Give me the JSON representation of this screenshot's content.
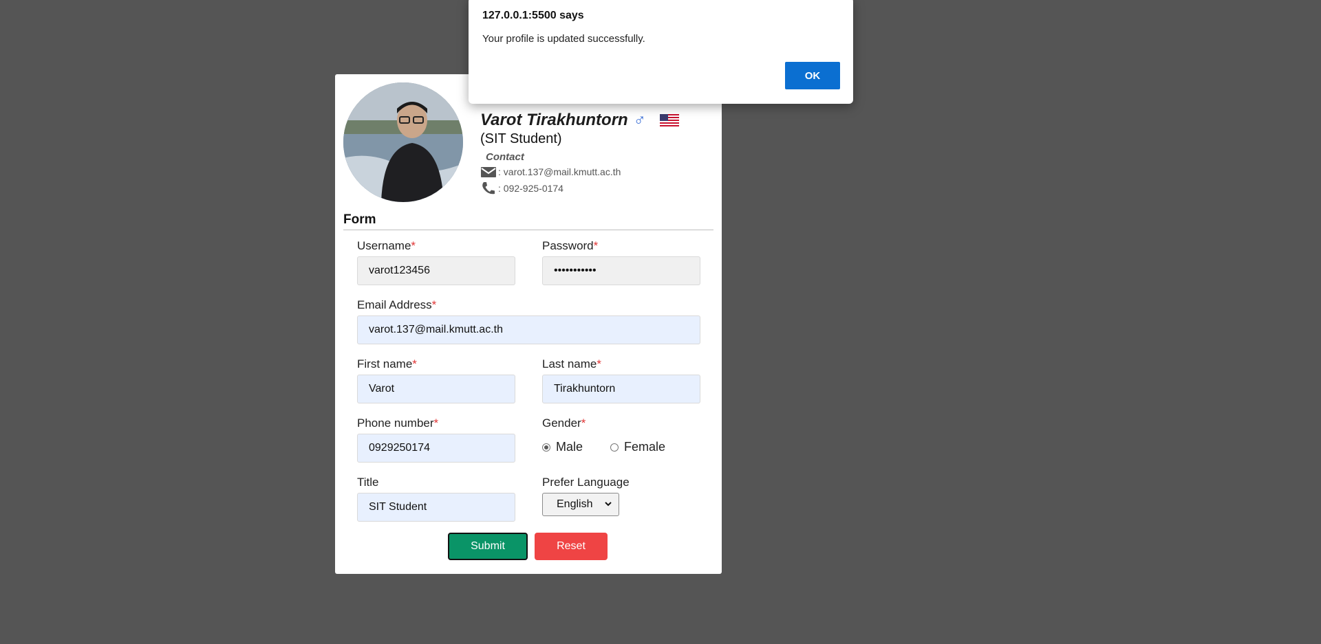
{
  "dialog": {
    "title": "127.0.0.1:5500 says",
    "message": "Your profile is updated successfully.",
    "ok_label": "OK"
  },
  "profile": {
    "name": "Varot Tirakhuntorn",
    "gender_symbol": "♂",
    "flag_icon": "us-flag-icon",
    "subtitle": "(SIT Student)",
    "contact_heading": "Contact",
    "email_line": ": varot.137@mail.kmutt.ac.th",
    "phone_line": ": 092-925-0174"
  },
  "form": {
    "title": "Form",
    "required_mark": "*",
    "username": {
      "label": "Username",
      "value": "varot123456"
    },
    "password": {
      "label": "Password",
      "value": "•••••••••••"
    },
    "email": {
      "label": "Email Address",
      "value": "varot.137@mail.kmutt.ac.th"
    },
    "first_name": {
      "label": "First name",
      "value": "Varot"
    },
    "last_name": {
      "label": "Last name",
      "value": "Tirakhuntorn"
    },
    "phone": {
      "label": "Phone number",
      "value": "0929250174"
    },
    "gender": {
      "label": "Gender",
      "options": [
        "Male",
        "Female"
      ],
      "selected": "Male"
    },
    "title_field": {
      "label": "Title",
      "value": "SIT Student"
    },
    "language": {
      "label": "Prefer Language",
      "selected": "English"
    },
    "submit_label": "Submit",
    "reset_label": "Reset"
  },
  "colors": {
    "background": "#555555",
    "submit": "#0a9467",
    "reset": "#ef4444",
    "dialog_ok": "#0b6fd1",
    "required": "#e03535"
  }
}
